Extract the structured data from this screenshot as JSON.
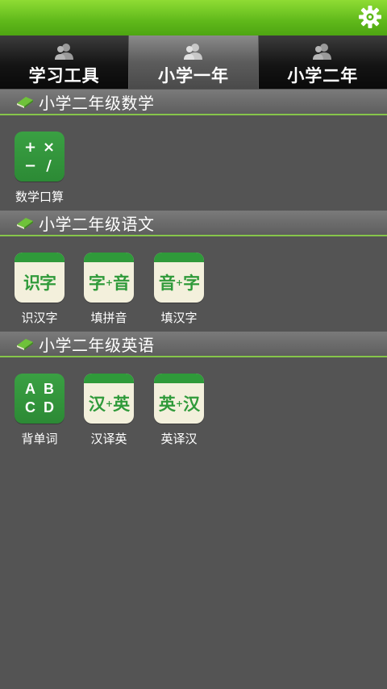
{
  "tabs": [
    {
      "label": "学习工具",
      "active": false
    },
    {
      "label": "小学一年",
      "active": true
    },
    {
      "label": "小学二年",
      "active": false
    }
  ],
  "sections": [
    {
      "title": "小学二年级数学",
      "items": [
        {
          "label": "数学口算",
          "icon": "math-operators-icon",
          "glyphs": [
            "+",
            "×",
            "−",
            "/"
          ]
        }
      ]
    },
    {
      "title": "小学二年级语文",
      "items": [
        {
          "label": "识汉字",
          "icon": "recognize-characters-icon",
          "glyph": "识字"
        },
        {
          "label": "填拼音",
          "icon": "character-to-pinyin-icon",
          "glyph_a": "字",
          "glyph_b": "音"
        },
        {
          "label": "填汉字",
          "icon": "pinyin-to-character-icon",
          "glyph_a": "音",
          "glyph_b": "字"
        }
      ]
    },
    {
      "title": "小学二年级英语",
      "items": [
        {
          "label": "背单词",
          "icon": "abcd-letters-icon",
          "glyphs": [
            "A",
            "B",
            "C",
            "D"
          ]
        },
        {
          "label": "汉译英",
          "icon": "chinese-to-english-icon",
          "glyph_a": "汉",
          "glyph_b": "英"
        },
        {
          "label": "英译汉",
          "icon": "english-to-chinese-icon",
          "glyph_a": "英",
          "glyph_b": "汉"
        }
      ]
    }
  ],
  "icons": {
    "settings": "gear-icon",
    "tab": "person-icon",
    "section": "book-icon"
  },
  "colors": {
    "accent_green": "#5fb81a",
    "card_green": "#2f9a3a",
    "background": "#545454"
  }
}
